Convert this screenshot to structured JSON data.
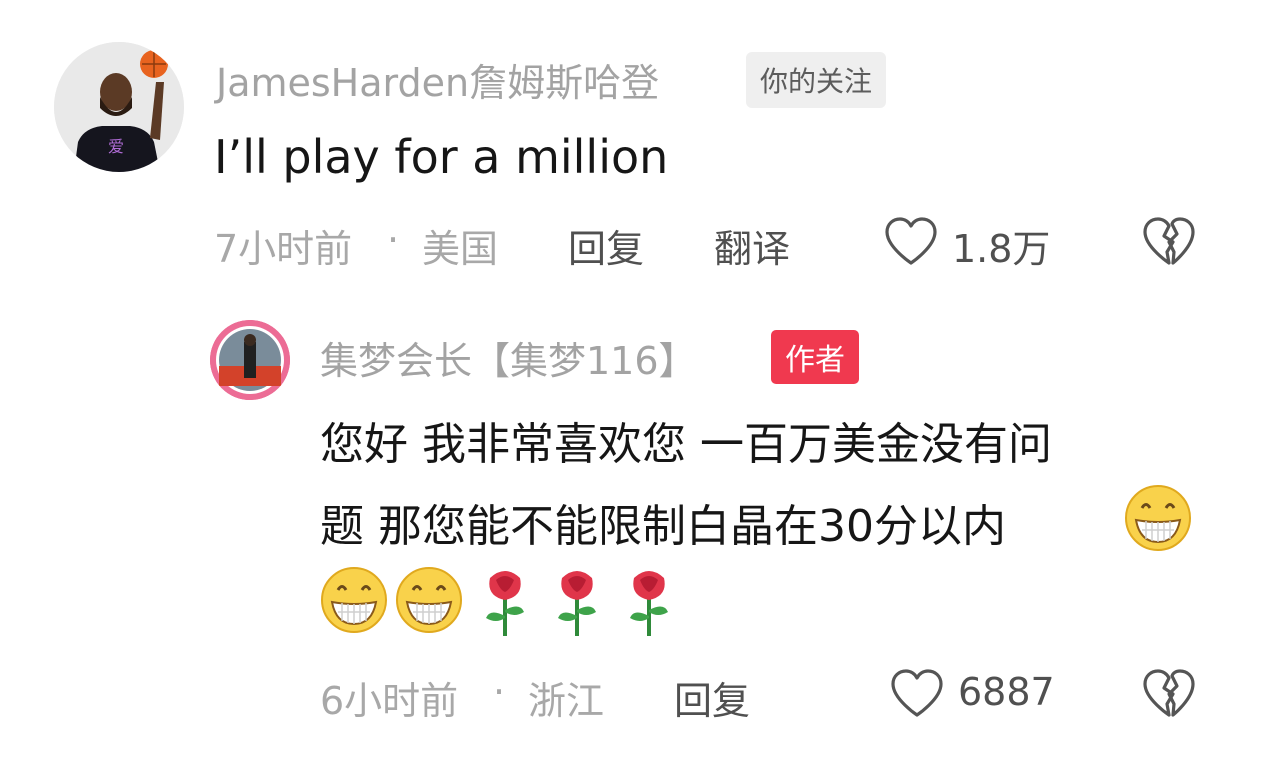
{
  "comment": {
    "username": "JamesHarden詹姆斯哈登",
    "follow_tag": "你的关注",
    "text": "I’ll play for a million",
    "time": "7小时前",
    "location": "美国",
    "reply_label": "回复",
    "translate_label": "翻译",
    "like_count": "1.8万"
  },
  "reply": {
    "username": "集梦会长【集梦116】",
    "author_tag": "作者",
    "text_line1": "您好 我非常喜欢您 一百万美金没有问",
    "text_line2": "题 那您能不能限制白晶在30分以内",
    "emojis": [
      "grin-emoji",
      "grin-emoji",
      "grin-emoji",
      "rose-emoji",
      "rose-emoji",
      "rose-emoji"
    ],
    "time": "6小时前",
    "location": "浙江",
    "reply_label": "回复",
    "like_count": "6887"
  },
  "separator": "·",
  "colors": {
    "username": "#a3a3a3",
    "author_tag": "#f0394f",
    "text": "#161616",
    "meta": "#a8a8a8"
  }
}
